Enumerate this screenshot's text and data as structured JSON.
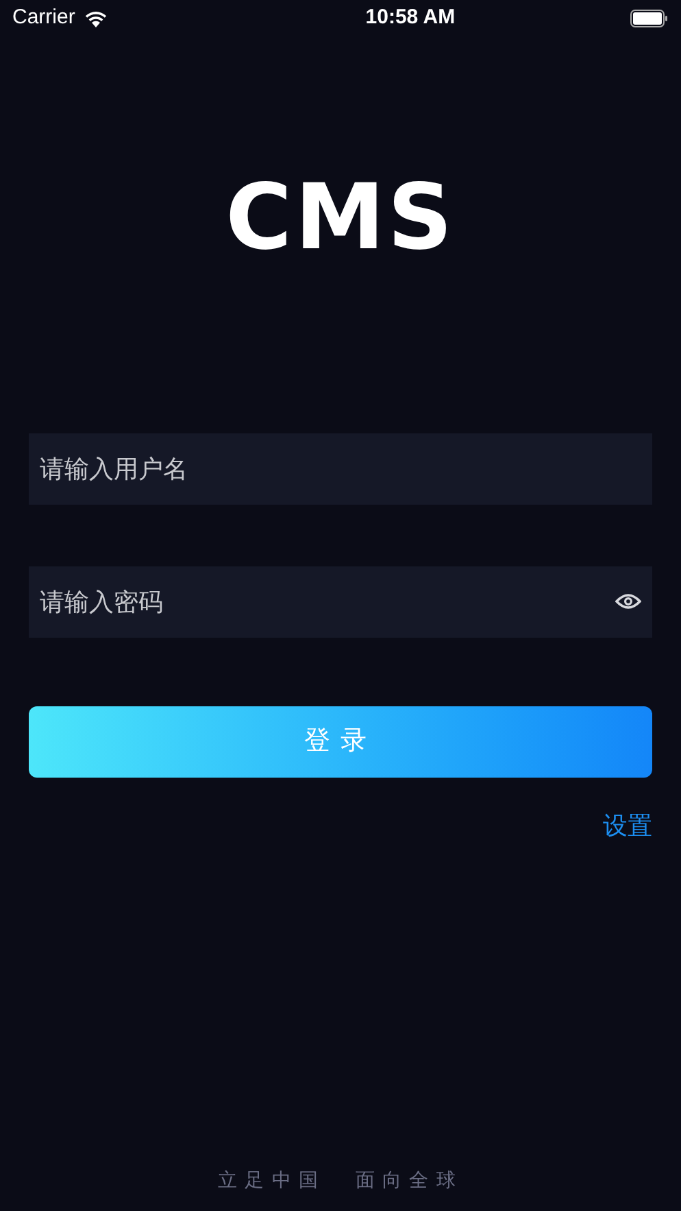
{
  "status_bar": {
    "carrier": "Carrier",
    "time": "10:58 AM"
  },
  "logo": {
    "text": "CMS"
  },
  "username": {
    "placeholder": "请输入用户名"
  },
  "password": {
    "placeholder": "请输入密码"
  },
  "login_button": {
    "label": "登录"
  },
  "settings_link": {
    "label": "设置"
  },
  "footer": [
    "立足中国",
    "面向全球"
  ]
}
